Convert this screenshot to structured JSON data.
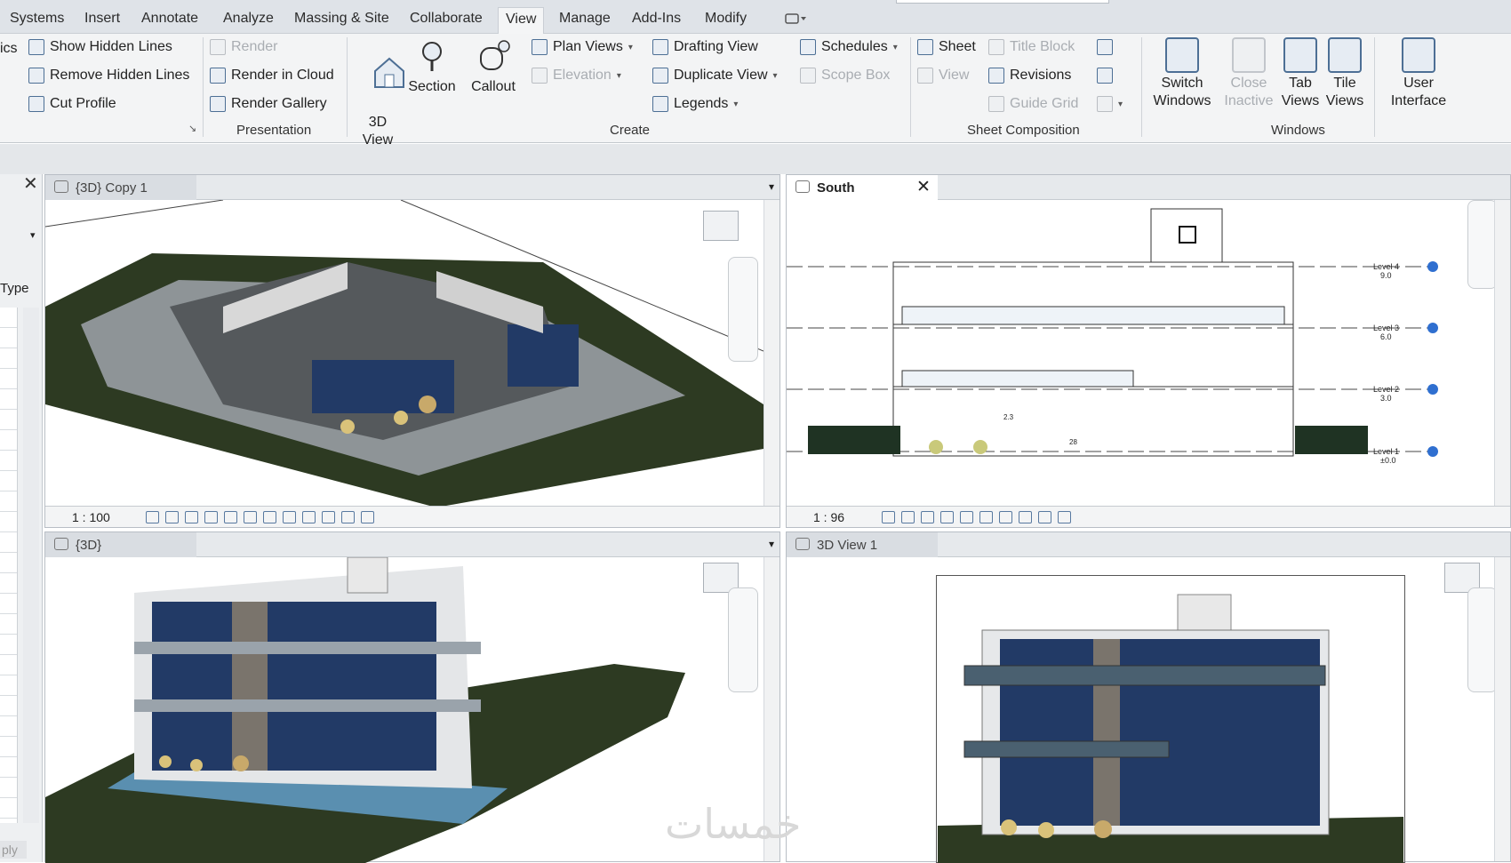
{
  "ribbon_tabs": [
    "Systems",
    "Insert",
    "Annotate",
    "Analyze",
    "Massing & Site",
    "Collaborate",
    "View",
    "Manage",
    "Add-Ins",
    "Modify"
  ],
  "active_tab": "View",
  "graphics": {
    "partial_panel": "ics",
    "show_hidden": "Show  Hidden Lines",
    "remove_hidden": "Remove  Hidden Lines",
    "cut_profile": "Cut  Profile"
  },
  "presentation": {
    "render": "Render",
    "render_cloud": "Render  in Cloud",
    "render_gallery": "Render  Gallery",
    "panel": "Presentation"
  },
  "create": {
    "view3d": "3D\nView",
    "section": "Section",
    "callout": "Callout",
    "plan_views": "Plan  Views",
    "elevation": "Elevation",
    "legends": "Legends",
    "drafting": "Drafting  View",
    "duplicate": "Duplicate  View",
    "schedules": "Schedules",
    "scope_box": "Scope  Box",
    "panel": "Create"
  },
  "sheet": {
    "sheet": "Sheet",
    "view": "View",
    "title_block": "Title  Block",
    "revisions": "Revisions",
    "guide_grid": "Guide  Grid",
    "panel": "Sheet Composition"
  },
  "windows": {
    "switch": "Switch\nWindows",
    "close_inactive": "Close\nInactive",
    "tab_views": "Tab\nViews",
    "tile_views": "Tile\nViews",
    "panel": "Windows"
  },
  "ui": {
    "user_interface": "User\nInterface"
  },
  "props": {
    "type_label": "Type",
    "apply": "ply"
  },
  "viewports": [
    {
      "title": "{3D} Copy 1",
      "scale": "1 : 100"
    },
    {
      "title": "South",
      "scale": "1 : 96"
    },
    {
      "title": "{3D}",
      "scale": ""
    },
    {
      "title": "3D View 1",
      "scale": ""
    }
  ],
  "levels": [
    {
      "name": "Level 4",
      "elev": "9.0"
    },
    {
      "name": "Level 3",
      "elev": "6.0"
    },
    {
      "name": "Level 2",
      "elev": "3.0"
    },
    {
      "name": "Level 1",
      "elev": "±0.0"
    }
  ],
  "dims": [
    "2.3",
    "28"
  ],
  "watermark": "خمسات",
  "colors": {
    "tab_bg": "#dfe3e8",
    "ribbon_bg": "#f3f4f5",
    "icon_blue": "#4d6f95",
    "glass": "#223a66",
    "grass": "#2d3a22"
  }
}
